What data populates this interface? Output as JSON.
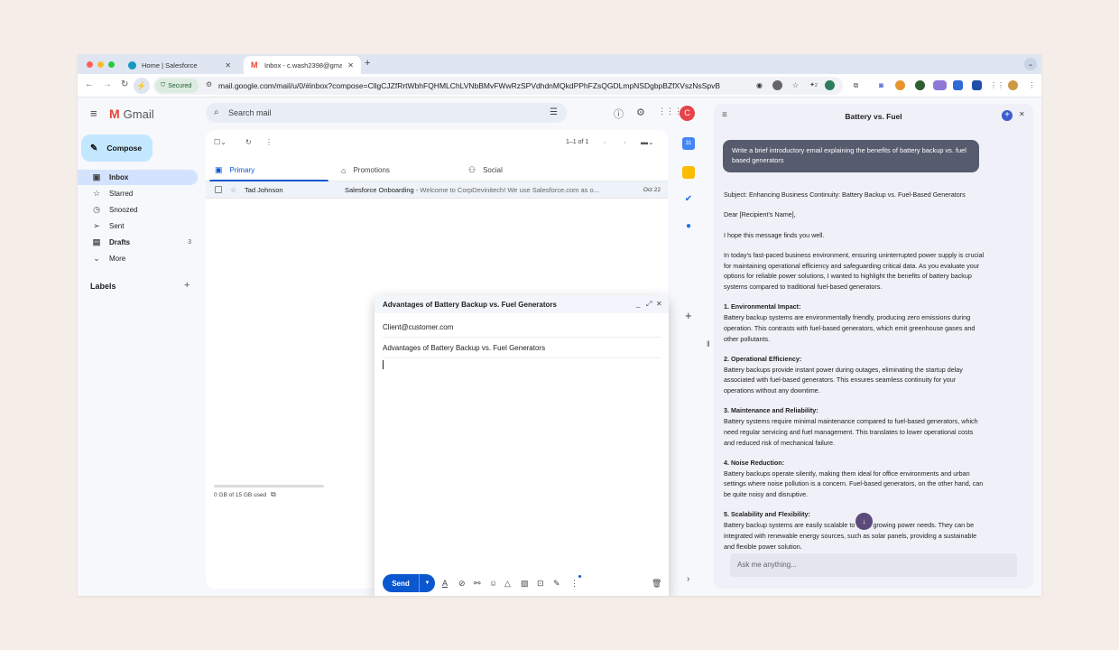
{
  "browser": {
    "tabs": [
      {
        "title": "Home | Salesforce",
        "active": false,
        "close": "✕"
      },
      {
        "title": "Inbox - c.wash2398@gmail.c",
        "active": true,
        "close": "✕"
      }
    ],
    "new_tab": "+",
    "url": "mail.google.com/mail/u/0/#inbox?compose=CllgCJZfRrtWbhFQHMLChLVNbBMvFWwRzSPVdhdnMQkdPPhFZsQGDLmpNSDgbpBZfXVszNsSpvB",
    "secured_label": "Secured",
    "colors": {
      "close": "#ff5f57",
      "minimize": "#febc2e",
      "maximize": "#28c840"
    },
    "extensions": [
      "eye-icon",
      "circle-icon",
      "star-icon",
      "badge-icon",
      "avatar-icon",
      "puzzle-icon",
      "camera-icon",
      "coin-icon",
      "leaf-icon",
      "chat-icon",
      "folder-icon",
      "tool-icon",
      "grid-icon",
      "profile-icon",
      "more-icon"
    ],
    "ext_badge": "2"
  },
  "gmail": {
    "logo_text": "Gmail",
    "compose_label": "Compose",
    "search_placeholder": "Search mail",
    "avatar_letter": "C",
    "nav": [
      {
        "label": "Inbox",
        "icon": "inbox-icon",
        "active": true,
        "count": ""
      },
      {
        "label": "Starred",
        "icon": "star-icon",
        "active": false,
        "count": ""
      },
      {
        "label": "Snoozed",
        "icon": "clock-icon",
        "active": false,
        "count": ""
      },
      {
        "label": "Sent",
        "icon": "send-icon",
        "active": false,
        "count": ""
      },
      {
        "label": "Drafts",
        "icon": "draft-icon",
        "active": false,
        "count": "3"
      },
      {
        "label": "More",
        "icon": "chevron-down-icon",
        "active": false,
        "count": ""
      }
    ],
    "labels_heading": "Labels",
    "pager": "1–1 of 1",
    "tabs": [
      {
        "label": "Primary",
        "icon": "inbox-icon",
        "active": true
      },
      {
        "label": "Promotions",
        "icon": "tag-icon",
        "active": false
      },
      {
        "label": "Social",
        "icon": "people-icon",
        "active": false
      }
    ],
    "emails": [
      {
        "sender": "Tad Johnson",
        "subject": "Salesforce Onboarding",
        "snippet": " - Welcome to CorpDevinitech! We use Salesforce.com as o...",
        "date": "Oct 22"
      }
    ],
    "storage": "0 GB of 15 GB used",
    "accent": "#0b57d0"
  },
  "compose_window": {
    "title": "Advantages of Battery Backup vs. Fuel Generators",
    "to": "Client@customer.com",
    "subject": "Advantages of Battery Backup vs. Fuel Generators",
    "send_label": "Send"
  },
  "assistant": {
    "title": "Battery vs. Fuel",
    "user_prompt": "Write a brief introductory email explaining the benefits of battery backup vs. fuel based generators",
    "subject_line": "Subject: Enhancing Business Continuity: Battery Backup vs. Fuel-Based Generators",
    "greeting": "Dear [Recipient's Name],",
    "opening": "I hope this message finds you well.",
    "intro": "In today's fast-paced business environment, ensuring uninterrupted power supply is crucial for maintaining operational efficiency and safeguarding critical data. As you evaluate your options for reliable power solutions, I wanted to highlight the benefits of battery backup systems compared to traditional fuel-based generators.",
    "sections": [
      {
        "heading": "1. Environmental Impact:",
        "body": "Battery backup systems are environmentally friendly, producing zero emissions during operation. This contrasts with fuel-based generators, which emit greenhouse gases and other pollutants."
      },
      {
        "heading": "2. Operational Efficiency:",
        "body": "Battery backups provide instant power during outages, eliminating the startup delay associated with fuel-based generators. This ensures seamless continuity for your operations without any downtime."
      },
      {
        "heading": "3. Maintenance and Reliability:",
        "body": "Battery systems require minimal maintenance compared to fuel-based generators, which need regular servicing and fuel management. This translates to lower operational costs and reduced risk of mechanical failure."
      },
      {
        "heading": "4. Noise Reduction:",
        "body": "Battery backups operate silently, making them ideal for office environments and urban settings where noise pollution is a concern. Fuel-based generators, on the other hand, can be quite noisy and disruptive."
      },
      {
        "heading": "5. Scalability and Flexibility:",
        "body": "Battery backup systems are easily scalable to meet growing power needs. They can be integrated with renewable energy sources, such as solar panels, providing a sustainable and flexible power solution."
      }
    ],
    "input_placeholder": "Ask me anything...",
    "bubble_color": "#565b6e"
  }
}
